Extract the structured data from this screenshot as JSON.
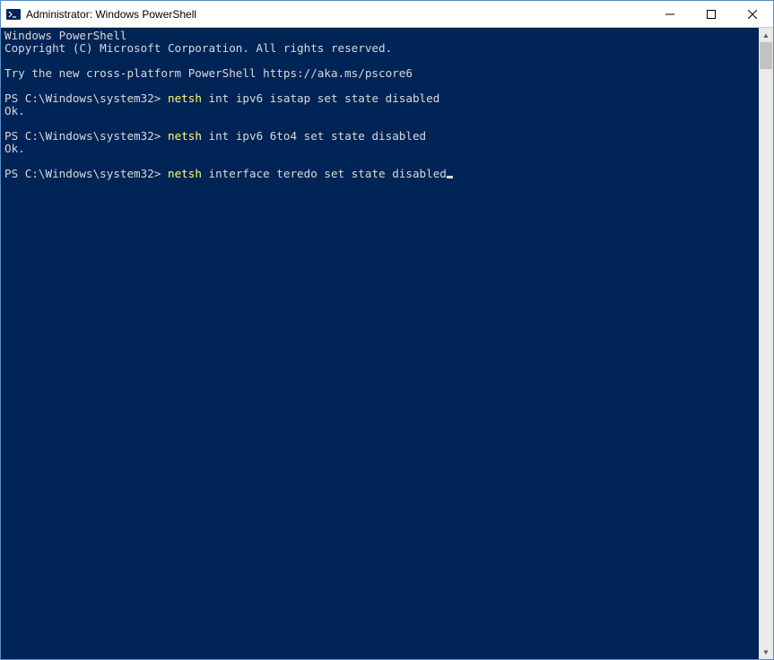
{
  "window": {
    "title": "Administrator: Windows PowerShell"
  },
  "terminal": {
    "header1": "Windows PowerShell",
    "header2": "Copyright (C) Microsoft Corporation. All rights reserved.",
    "header3": "Try the new cross-platform PowerShell https://aka.ms/pscore6",
    "prompt": "PS C:\\Windows\\system32> ",
    "cmd_keyword": "netsh",
    "cmd1_args": " int ipv6 isatap set state disabled",
    "ok": "Ok.",
    "cmd2_args": " int ipv6 6to4 set state disabled",
    "cmd3_args": " interface teredo set state disabled"
  }
}
